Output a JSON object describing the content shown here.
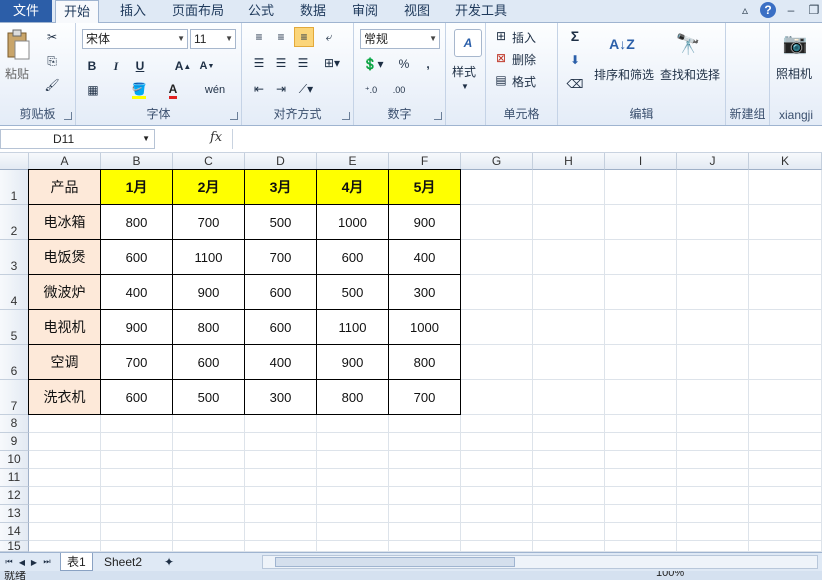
{
  "tabs": {
    "file": "文件",
    "items": [
      "开始",
      "插入",
      "页面布局",
      "公式",
      "数据",
      "审阅",
      "视图",
      "开发工具"
    ]
  },
  "ribbon": {
    "clipboard": {
      "label": "剪贴板",
      "paste": "粘贴"
    },
    "font": {
      "label": "字体",
      "name": "宋体",
      "size": "11",
      "bold": "B",
      "italic": "I",
      "underline": "U"
    },
    "align": {
      "label": "对齐方式"
    },
    "number": {
      "label": "数字",
      "format": "常规",
      "percent": "%",
      "comma": ","
    },
    "styles": {
      "label": "样式"
    },
    "cells": {
      "label": "单元格",
      "insert": "插入",
      "delete": "删除",
      "format": "格式"
    },
    "editing": {
      "label": "编辑",
      "sort": "排序和筛选",
      "find": "查找和选择",
      "sigma": "Σ"
    },
    "newgroup": {
      "label": "新建组"
    },
    "xiangji": {
      "label": "xiangji",
      "camera": "照相机"
    }
  },
  "formula_bar": {
    "name_box": "D11",
    "fx": "fx",
    "value": ""
  },
  "columns": [
    "A",
    "B",
    "C",
    "D",
    "E",
    "F",
    "G",
    "H",
    "I",
    "J",
    "K"
  ],
  "rows": [
    "1",
    "2",
    "3",
    "4",
    "5",
    "6",
    "7",
    "8",
    "9",
    "10",
    "11",
    "12",
    "13",
    "14",
    "15"
  ],
  "table": {
    "header": [
      "产品",
      "1月",
      "2月",
      "3月",
      "4月",
      "5月"
    ],
    "body": [
      [
        "电冰箱",
        "800",
        "700",
        "500",
        "1000",
        "900"
      ],
      [
        "电饭煲",
        "600",
        "1100",
        "700",
        "600",
        "400"
      ],
      [
        "微波炉",
        "400",
        "900",
        "600",
        "500",
        "300"
      ],
      [
        "电视机",
        "900",
        "800",
        "600",
        "1100",
        "1000"
      ],
      [
        "空调",
        "700",
        "600",
        "400",
        "900",
        "800"
      ],
      [
        "洗衣机",
        "600",
        "500",
        "300",
        "800",
        "700"
      ]
    ]
  },
  "sheets": [
    "表1",
    "Sheet2"
  ],
  "status": {
    "ready": "就绪",
    "zoom": "100%"
  }
}
